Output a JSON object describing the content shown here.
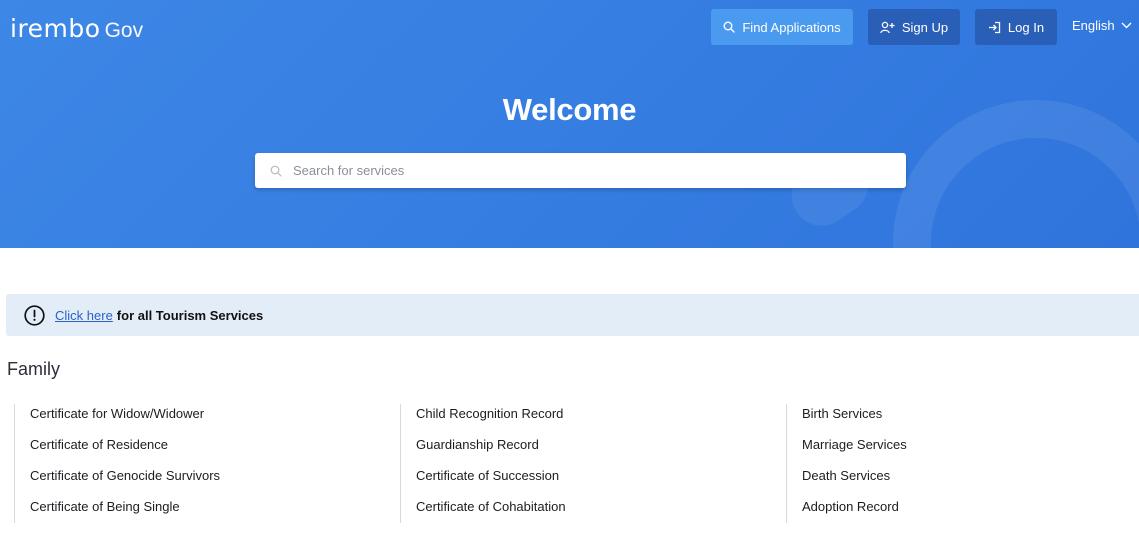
{
  "header": {
    "logo_main": "irembo",
    "logo_sub": "Gov",
    "find_applications_label": "Find Applications",
    "sign_up_label": "Sign Up",
    "log_in_label": "Log In",
    "language": "English",
    "icons": {
      "find": "search-icon",
      "sign_up": "add-user-icon",
      "log_in": "login-icon",
      "language": "chevron-down-icon"
    }
  },
  "hero": {
    "title": "Welcome",
    "search_placeholder": "Search for services",
    "background_color": "#3680e2"
  },
  "banner": {
    "link_text": "Click here",
    "text": "for all Tourism Services",
    "icon": "info-circle-icon"
  },
  "family": {
    "title": "Family",
    "columns": [
      [
        "Certificate for Widow/Widower",
        "Certificate of Residence",
        "Certificate of Genocide Survivors",
        "Certificate of Being Single"
      ],
      [
        "Child Recognition Record",
        "Guardianship Record",
        "Certificate of Succession",
        "Certificate of Cohabitation"
      ],
      [
        "Birth Services",
        "Marriage Services",
        "Death Services",
        "Adoption Record"
      ]
    ]
  }
}
